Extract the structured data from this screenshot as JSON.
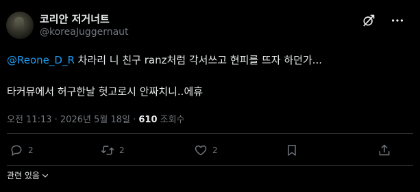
{
  "author": {
    "name": "코리안 저거너트",
    "handle": "@koreaJuggernaut"
  },
  "tweet": {
    "mention": "@Reone_D_R",
    "line1_rest": " 차라리 니 친구 ranz처럼 각서쓰고 현피를 뜨자 하던가...",
    "line2": "타커뮤에서 허구한날 헛고로시 안짜치니..에휴"
  },
  "meta": {
    "timestamp": "오전 11:13 · 2026년 5월 18일 · ",
    "views_count": "610",
    "views_label": " 조회수"
  },
  "actions": {
    "reply_count": "2",
    "retweet_count": "2",
    "like_count": "2"
  },
  "footer": {
    "related_label": "관련 있음"
  },
  "icons": [
    "grok-icon",
    "more-icon",
    "reply-icon",
    "retweet-icon",
    "like-icon",
    "bookmark-icon",
    "share-icon",
    "chevron-down-icon"
  ],
  "colors": {
    "background": "#000000",
    "text": "#e7e9ea",
    "secondary": "#71767b",
    "link": "#1d9bf0",
    "divider": "#2f3336"
  }
}
